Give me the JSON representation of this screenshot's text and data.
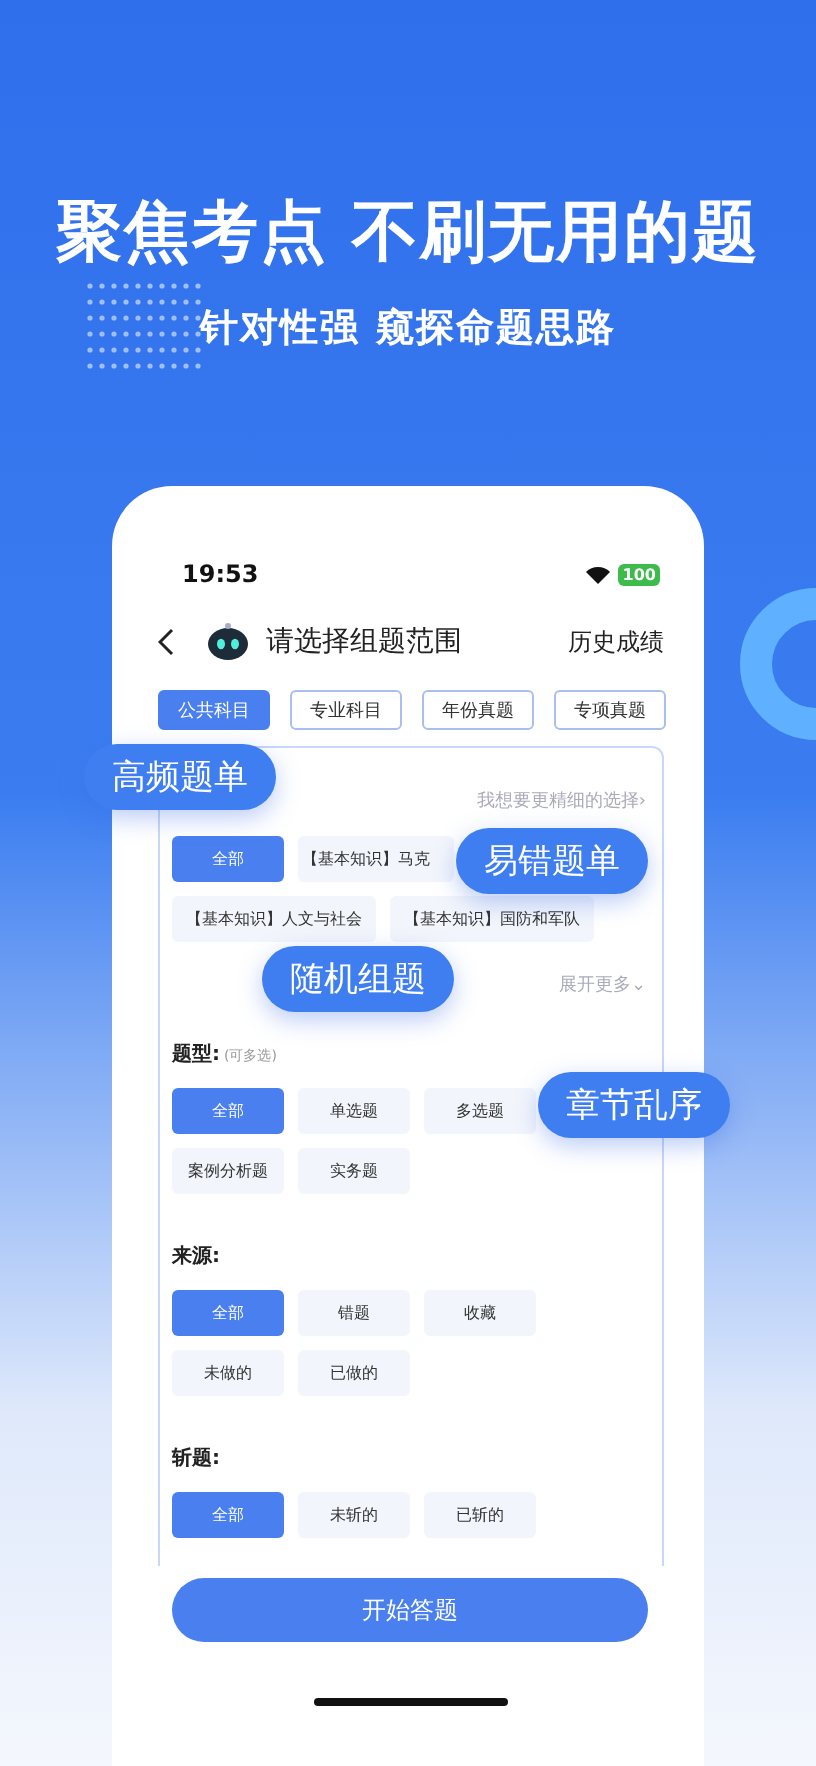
{
  "headline": "聚焦考点 不刷无用的题",
  "subheadline": "针对性强 窥探命题思路",
  "phone": {
    "status_time": "19:53",
    "battery": "100",
    "nav_title": "请选择组题范围",
    "nav_action": "历史成绩",
    "tabs": [
      {
        "label": "公共科目",
        "selected": true
      },
      {
        "label": "专业科目",
        "selected": false
      },
      {
        "label": "年份真题",
        "selected": false
      },
      {
        "label": "专项真题",
        "selected": false
      }
    ],
    "refine_link": "我想要更精细的选择›",
    "subjects": [
      {
        "label": "全部",
        "selected": true
      },
      {
        "label": "【基本知识】马克",
        "selected": false
      },
      {
        "label": "【基本知识】人文与社会",
        "selected": false
      },
      {
        "label": "【基本知识】国防和军队",
        "selected": false
      }
    ],
    "expand_link": "展开更多⌄",
    "sections": [
      {
        "title": "题型:",
        "hint": "(可多选)",
        "options": [
          {
            "label": "全部",
            "selected": true
          },
          {
            "label": "单选题",
            "selected": false
          },
          {
            "label": "多选题",
            "selected": false
          },
          {
            "label": "案例分析题",
            "selected": false
          },
          {
            "label": "实务题",
            "selected": false
          }
        ]
      },
      {
        "title": "来源:",
        "options": [
          {
            "label": "全部",
            "selected": true
          },
          {
            "label": "错题",
            "selected": false
          },
          {
            "label": "收藏",
            "selected": false
          },
          {
            "label": "未做的",
            "selected": false
          },
          {
            "label": "已做的",
            "selected": false
          }
        ]
      },
      {
        "title": "斩题:",
        "options": [
          {
            "label": "全部",
            "selected": true
          },
          {
            "label": "未斩的",
            "selected": false
          },
          {
            "label": "已斩的",
            "selected": false
          }
        ]
      }
    ],
    "start_button": "开始答题"
  },
  "bubbles": [
    "高频题单",
    "易错题单",
    "随机组题",
    "章节乱序"
  ]
}
